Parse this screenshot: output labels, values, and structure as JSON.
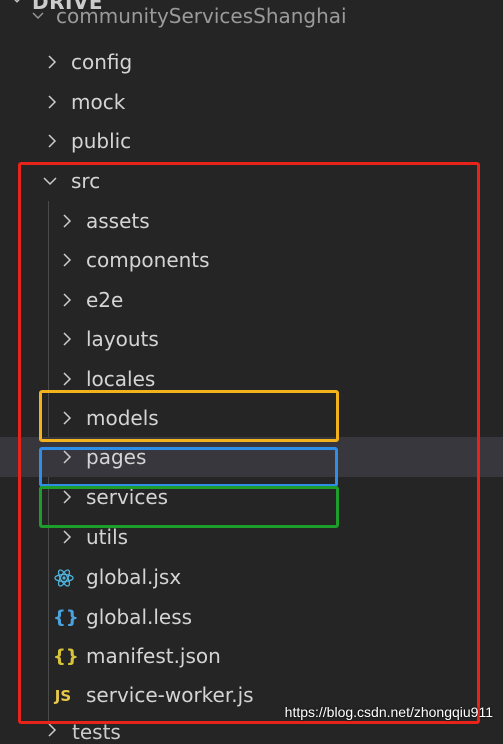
{
  "explorer": {
    "section_title": "DRIVE",
    "root_folder": "communityServicesShanghai",
    "top_items": [
      {
        "label": "config"
      },
      {
        "label": "mock"
      },
      {
        "label": "public"
      }
    ],
    "src": {
      "label": "src",
      "folders": [
        {
          "label": "assets"
        },
        {
          "label": "components"
        },
        {
          "label": "e2e"
        },
        {
          "label": "layouts"
        },
        {
          "label": "locales"
        },
        {
          "label": "models"
        },
        {
          "label": "pages"
        },
        {
          "label": "services"
        },
        {
          "label": "utils"
        }
      ],
      "files": [
        {
          "label": "global.jsx",
          "icon": "react-icon"
        },
        {
          "label": "global.less",
          "icon": "braces-icon"
        },
        {
          "label": "manifest.json",
          "icon": "json-braces-icon"
        },
        {
          "label": "service-worker.js",
          "icon": "js-icon"
        }
      ]
    },
    "next_item": "tests"
  },
  "colors": {
    "red_box": "#e8231a",
    "yellow_box": "#f3b21b",
    "blue_box": "#2f8ee8",
    "green_box": "#1d9e2a"
  },
  "watermark": "https://blog.csdn.net/zhongqiu911"
}
